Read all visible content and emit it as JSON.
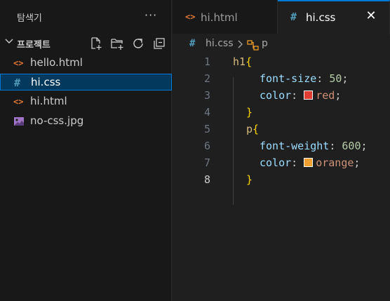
{
  "sidebar": {
    "title": "탐색기",
    "more": "···",
    "project": {
      "name": "프로젝트",
      "actions": [
        "new-file-icon",
        "new-folder-icon",
        "refresh-icon",
        "collapse-all-icon"
      ]
    },
    "files": [
      {
        "icon": "<>",
        "name": "hello.html",
        "type": "html",
        "selected": false
      },
      {
        "icon": "#",
        "name": "hi.css",
        "type": "css",
        "selected": true
      },
      {
        "icon": "<>",
        "name": "hi.html",
        "type": "html",
        "selected": false
      },
      {
        "icon": "image-icon",
        "name": "no-css.jpg",
        "type": "image",
        "selected": false
      }
    ]
  },
  "tabs": [
    {
      "icon": "<>",
      "label": "hi.html",
      "active": false
    },
    {
      "icon": "#",
      "label": "hi.css",
      "active": true,
      "close": "✕"
    }
  ],
  "breadcrumb": {
    "hash": "#",
    "file": "hi.css",
    "separator": ">",
    "symbol": "p"
  },
  "editor": {
    "line_numbers": [
      "1",
      "2",
      "3",
      "4",
      "5",
      "6",
      "7",
      "8"
    ],
    "active_line": "8",
    "lines": {
      "l1_selector": "h1",
      "l1_brace": "{",
      "l2_prop": "font-size",
      "l2_colon": ": ",
      "l2_value": "50",
      "l2_semi": ";",
      "l3_prop": "color",
      "l3_colon": ": ",
      "l3_value": "red",
      "l3_semi": ";",
      "l4_brace": "}",
      "l5_selector": "p",
      "l5_brace": "{",
      "l6_prop": "font-weight",
      "l6_colon": ": ",
      "l6_value": "600",
      "l6_semi": ";",
      "l7_prop": "color",
      "l7_colon": ": ",
      "l7_value": "orange",
      "l7_semi": ";",
      "l8_brace": "}"
    },
    "swatches": {
      "red": "#e03c31",
      "orange": "#f0a030"
    }
  },
  "colors": {
    "accent": "#0078d4",
    "html_icon": "#e37933",
    "css_icon": "#519aba"
  }
}
